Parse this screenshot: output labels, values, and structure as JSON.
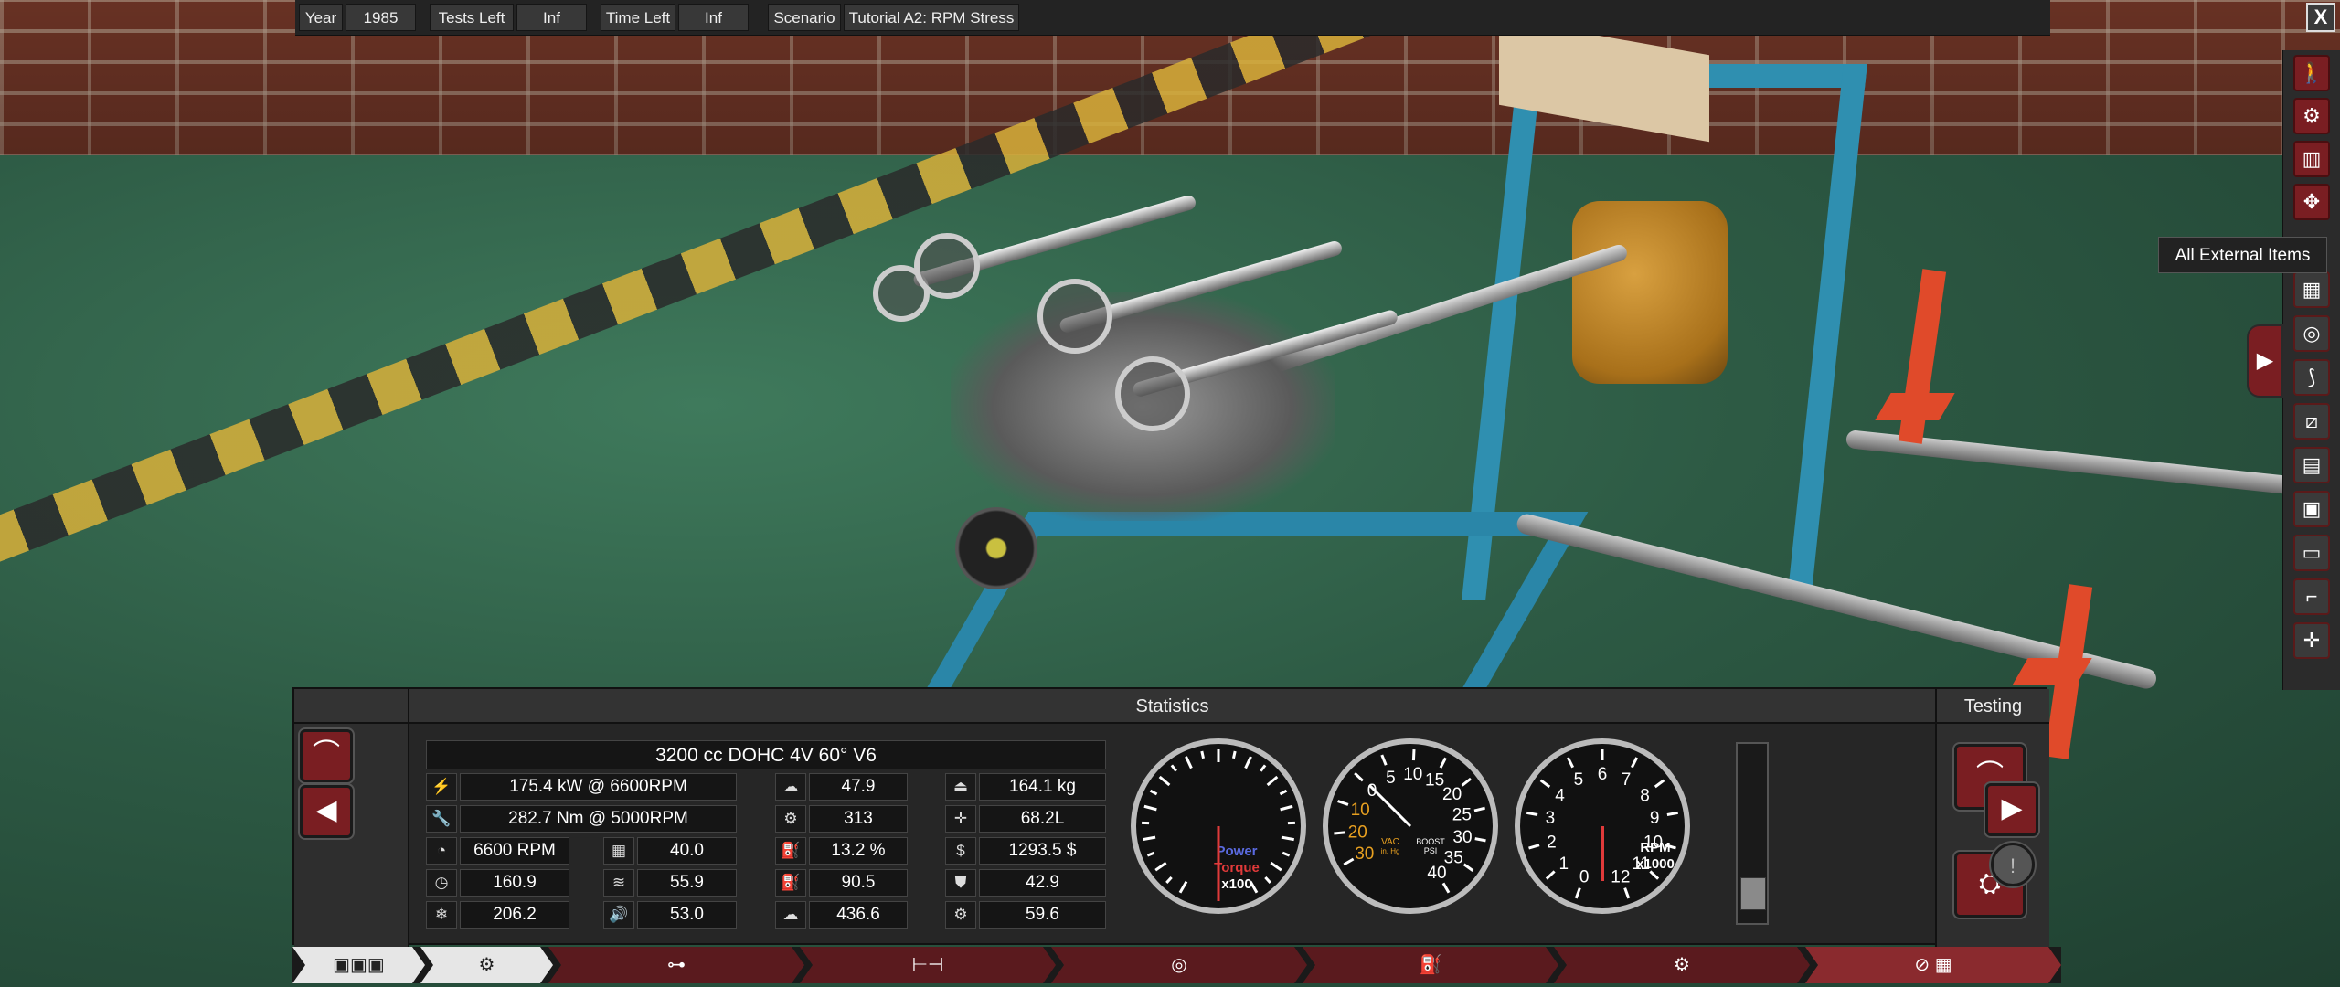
{
  "topbar": {
    "year_label": "Year",
    "year_value": "1985",
    "tests_label": "Tests Left",
    "tests_value": "Inf",
    "time_label": "Time Left",
    "time_value": "Inf",
    "scenario_label": "Scenario",
    "scenario_value": "Tutorial A2: RPM Stress",
    "close_label": "X"
  },
  "tooltip": "All External Items",
  "right_toolbar": {
    "icons": [
      "walker-icon",
      "crankshaft-icon",
      "piston-icon",
      "cylinder-head-icon",
      "engine-block-icon",
      "intake-icon",
      "turbo-icon",
      "exhaust-icon",
      "fuel-icon",
      "radiator-icon",
      "box-icon",
      "tray-icon",
      "bracket-icon",
      "move-icon"
    ],
    "expand_tab": "▶"
  },
  "panel": {
    "statistics_title": "Statistics",
    "testing_title": "Testing",
    "engine_name": "3200 cc DOHC 4V 60° V6",
    "stats": {
      "power": "175.4 kW @ 6600RPM",
      "torque": "282.7 Nm @ 5000RPM",
      "rpm": "6600 RPM",
      "cooling": "40.0",
      "val_160": "160.9",
      "smooth": "55.9",
      "cold": "206.2",
      "noise": "53.0",
      "c2r1": "47.9",
      "c2r2": "313",
      "c2r3": "13.2 %",
      "c2r4": "90.5",
      "c2r5": "436.6",
      "weight": "164.1 kg",
      "volume": "68.2L",
      "cost": "1293.5 $",
      "c3r4": "42.9",
      "c3r5": "59.6"
    }
  },
  "gauges": {
    "power_torque": {
      "label_power": "Power",
      "label_torque": "Torque",
      "scale": "x100",
      "needle_value": 0
    },
    "boost": {
      "ticks": [
        "30",
        "20",
        "10",
        "0",
        "5",
        "10",
        "15",
        "20",
        "25",
        "30",
        "35",
        "40"
      ],
      "vac_label": "VAC",
      "vac_unit": "in. Hg",
      "boost_label": "BOOST",
      "boost_unit": "PSI",
      "needle_value": 0
    },
    "rpm": {
      "ticks": [
        "0",
        "1",
        "2",
        "3",
        "4",
        "5",
        "6",
        "7",
        "8",
        "9",
        "10",
        "11",
        "12"
      ],
      "label": "RPM",
      "scale": "x1000",
      "needle_value": 0
    }
  },
  "slider": {
    "level_fraction": 0.1
  },
  "tabs": [
    "block-icon",
    "head-icon",
    "crank-icon",
    "timing-icon",
    "turbo-icon",
    "fuel-icon",
    "exhaust-icon",
    "test-icon"
  ],
  "colors": {
    "accent": "#7a1e22",
    "power": "#5a6ae0",
    "torque": "#e03a3a",
    "boost_tick": "#e8a020"
  }
}
